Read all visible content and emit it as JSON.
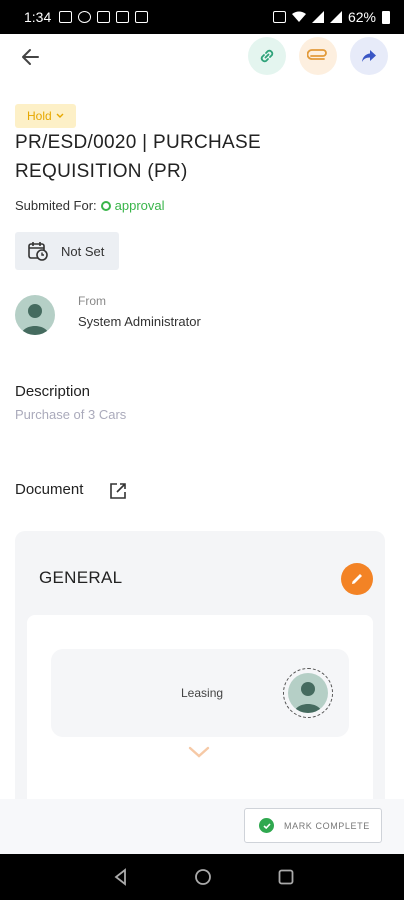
{
  "status_bar": {
    "time": "1:34",
    "battery": "62%"
  },
  "toolbar": {
    "back_icon": "arrow-left-icon",
    "link_icon": "link-icon",
    "attach_icon": "paperclip-icon",
    "share_icon": "share-icon"
  },
  "status_badge": "Hold",
  "title": "PR/ESD/0020 | PURCHASE REQUISITION (PR)",
  "submitted": {
    "label": "Submited For:",
    "value": "approval"
  },
  "due_date": "Not Set",
  "from": {
    "label": "From",
    "name": "System Administrator"
  },
  "description": {
    "label": "Description",
    "value": "Purchase of 3 Cars"
  },
  "document": {
    "label": "Document"
  },
  "general_card": {
    "title": "GENERAL",
    "item_label": "Leasing"
  },
  "mark_complete": "MARK COMPLETE",
  "colors": {
    "accent_orange": "#f38325",
    "hold_bg": "#fdf0c7",
    "hold_text": "#e6a700",
    "green": "#39b54a"
  }
}
